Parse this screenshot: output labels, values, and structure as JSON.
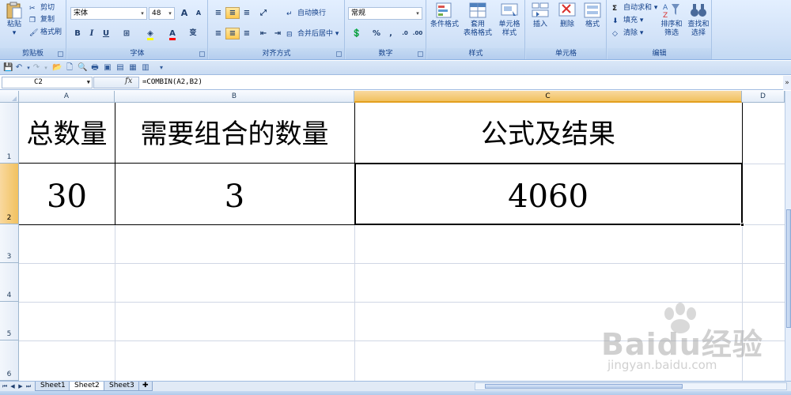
{
  "ribbon": {
    "clipboard": {
      "paste": "粘贴",
      "cut": "剪切",
      "copy": "复制",
      "format_painter": "格式刷",
      "label": "剪贴板"
    },
    "font": {
      "name": "宋体",
      "size": "48",
      "grow": "A",
      "shrink": "A",
      "bold": "B",
      "italic": "I",
      "underline": "U",
      "wen": "变",
      "label": "字体"
    },
    "alignment": {
      "wrap": "自动换行",
      "merge": "合并后居中",
      "label": "对齐方式"
    },
    "number": {
      "format": "常规",
      "percent": "%",
      "comma": ",",
      "label": "数字"
    },
    "styles": {
      "conditional": "条件格式",
      "table_line1": "套用",
      "table_line2": "表格格式",
      "cell_line1": "单元格",
      "cell_line2": "样式",
      "label": "样式"
    },
    "cells": {
      "insert": "插入",
      "delete": "删除",
      "format": "格式",
      "label": "单元格"
    },
    "editing": {
      "autosum": "自动求和",
      "fill": "填充",
      "clear": "清除",
      "sort_line1": "排序和",
      "sort_line2": "筛选",
      "find_line1": "查找和",
      "find_line2": "选择",
      "label": "编辑"
    }
  },
  "formula_bar": {
    "name_box": "C2",
    "fx": "fx",
    "formula": "=COMBIN(A2,B2)"
  },
  "columns": [
    "A",
    "B",
    "C",
    "D"
  ],
  "rows": [
    "1",
    "2",
    "3",
    "4",
    "5",
    "6"
  ],
  "cells": {
    "A1": "总数量",
    "B1": "需要组合的数量",
    "C1": "公式及结果",
    "A2": "30",
    "B2": "3",
    "C2": "4060"
  },
  "sheets": [
    "Sheet1",
    "Sheet2",
    "Sheet3"
  ],
  "active_sheet": "Sheet2",
  "watermark": {
    "main": "Baidu经验",
    "sub": "jingyan.baidu.com"
  },
  "colors": {
    "selection_header": "#f1c15f",
    "grid": "#d0d7e5",
    "ribbon": "#d3e3f8"
  }
}
